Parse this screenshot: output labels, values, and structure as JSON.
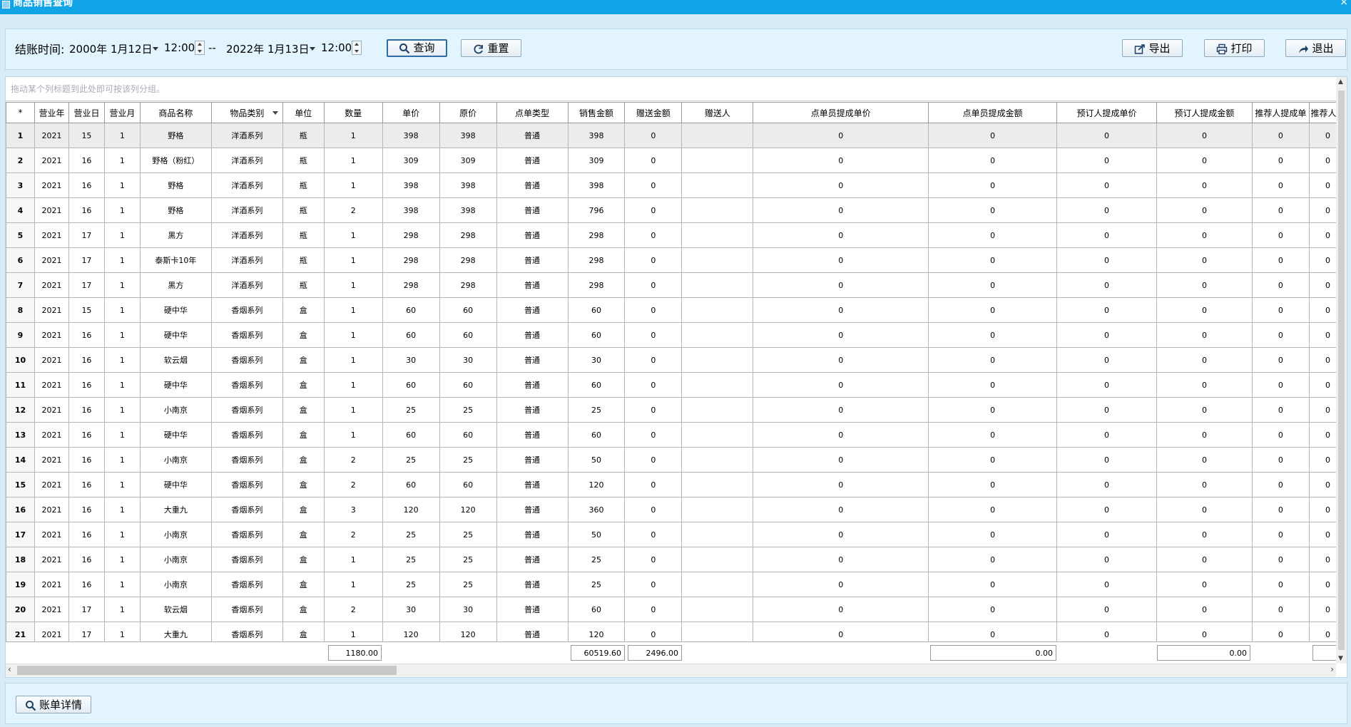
{
  "window": {
    "title": "商品销售查询",
    "close": "×"
  },
  "toolbar": {
    "label": "结账时间:",
    "start_date": "2000年 1月12日",
    "start_time": "12:00",
    "separator": "--",
    "end_date": "2022年 1月13日",
    "end_time": "12:00",
    "query": "查询",
    "reset": "重置",
    "export": "导出",
    "print": "打印",
    "exit": "退出"
  },
  "grid": {
    "group_hint": "拖动某个列标题到此处即可按该列分组。",
    "columns": [
      "*",
      "营业年",
      "营业日",
      "营业月",
      "商品名称",
      "物品类别",
      "单位",
      "数量",
      "单价",
      "原价",
      "点单类型",
      "销售金额",
      "赠送金额",
      "赠送人",
      "点单员提成单价",
      "点单员提成金额",
      "预订人提成单价",
      "预订人提成金额",
      "推荐人提成单",
      "推荐人提"
    ],
    "rows": [
      [
        "1",
        "2021",
        "15",
        "1",
        "野格",
        "洋酒系列",
        "瓶",
        "1",
        "398",
        "398",
        "普通",
        "398",
        "0",
        "",
        "0",
        "0",
        "0",
        "0",
        "0",
        "0"
      ],
      [
        "2",
        "2021",
        "16",
        "1",
        "野格（粉红）",
        "洋酒系列",
        "瓶",
        "1",
        "309",
        "309",
        "普通",
        "309",
        "0",
        "",
        "0",
        "0",
        "0",
        "0",
        "0",
        "0"
      ],
      [
        "3",
        "2021",
        "16",
        "1",
        "野格",
        "洋酒系列",
        "瓶",
        "1",
        "398",
        "398",
        "普通",
        "398",
        "0",
        "",
        "0",
        "0",
        "0",
        "0",
        "0",
        "0"
      ],
      [
        "4",
        "2021",
        "16",
        "1",
        "野格",
        "洋酒系列",
        "瓶",
        "2",
        "398",
        "398",
        "普通",
        "796",
        "0",
        "",
        "0",
        "0",
        "0",
        "0",
        "0",
        "0"
      ],
      [
        "5",
        "2021",
        "17",
        "1",
        "黑方",
        "洋酒系列",
        "瓶",
        "1",
        "298",
        "298",
        "普通",
        "298",
        "0",
        "",
        "0",
        "0",
        "0",
        "0",
        "0",
        "0"
      ],
      [
        "6",
        "2021",
        "17",
        "1",
        "泰斯卡10年",
        "洋酒系列",
        "瓶",
        "1",
        "298",
        "298",
        "普通",
        "298",
        "0",
        "",
        "0",
        "0",
        "0",
        "0",
        "0",
        "0"
      ],
      [
        "7",
        "2021",
        "17",
        "1",
        "黑方",
        "洋酒系列",
        "瓶",
        "1",
        "298",
        "298",
        "普通",
        "298",
        "0",
        "",
        "0",
        "0",
        "0",
        "0",
        "0",
        "0"
      ],
      [
        "8",
        "2021",
        "15",
        "1",
        "硬中华",
        "香烟系列",
        "盒",
        "1",
        "60",
        "60",
        "普通",
        "60",
        "0",
        "",
        "0",
        "0",
        "0",
        "0",
        "0",
        "0"
      ],
      [
        "9",
        "2021",
        "16",
        "1",
        "硬中华",
        "香烟系列",
        "盒",
        "1",
        "60",
        "60",
        "普通",
        "60",
        "0",
        "",
        "0",
        "0",
        "0",
        "0",
        "0",
        "0"
      ],
      [
        "10",
        "2021",
        "16",
        "1",
        "软云烟",
        "香烟系列",
        "盒",
        "1",
        "30",
        "30",
        "普通",
        "30",
        "0",
        "",
        "0",
        "0",
        "0",
        "0",
        "0",
        "0"
      ],
      [
        "11",
        "2021",
        "16",
        "1",
        "硬中华",
        "香烟系列",
        "盒",
        "1",
        "60",
        "60",
        "普通",
        "60",
        "0",
        "",
        "0",
        "0",
        "0",
        "0",
        "0",
        "0"
      ],
      [
        "12",
        "2021",
        "16",
        "1",
        "小南京",
        "香烟系列",
        "盒",
        "1",
        "25",
        "25",
        "普通",
        "25",
        "0",
        "",
        "0",
        "0",
        "0",
        "0",
        "0",
        "0"
      ],
      [
        "13",
        "2021",
        "16",
        "1",
        "硬中华",
        "香烟系列",
        "盒",
        "1",
        "60",
        "60",
        "普通",
        "60",
        "0",
        "",
        "0",
        "0",
        "0",
        "0",
        "0",
        "0"
      ],
      [
        "14",
        "2021",
        "16",
        "1",
        "小南京",
        "香烟系列",
        "盒",
        "2",
        "25",
        "25",
        "普通",
        "50",
        "0",
        "",
        "0",
        "0",
        "0",
        "0",
        "0",
        "0"
      ],
      [
        "15",
        "2021",
        "16",
        "1",
        "硬中华",
        "香烟系列",
        "盒",
        "2",
        "60",
        "60",
        "普通",
        "120",
        "0",
        "",
        "0",
        "0",
        "0",
        "0",
        "0",
        "0"
      ],
      [
        "16",
        "2021",
        "16",
        "1",
        "大重九",
        "香烟系列",
        "盒",
        "3",
        "120",
        "120",
        "普通",
        "360",
        "0",
        "",
        "0",
        "0",
        "0",
        "0",
        "0",
        "0"
      ],
      [
        "17",
        "2021",
        "16",
        "1",
        "小南京",
        "香烟系列",
        "盒",
        "2",
        "25",
        "25",
        "普通",
        "50",
        "0",
        "",
        "0",
        "0",
        "0",
        "0",
        "0",
        "0"
      ],
      [
        "18",
        "2021",
        "16",
        "1",
        "小南京",
        "香烟系列",
        "盒",
        "1",
        "25",
        "25",
        "普通",
        "25",
        "0",
        "",
        "0",
        "0",
        "0",
        "0",
        "0",
        "0"
      ],
      [
        "19",
        "2021",
        "16",
        "1",
        "小南京",
        "香烟系列",
        "盒",
        "1",
        "25",
        "25",
        "普通",
        "25",
        "0",
        "",
        "0",
        "0",
        "0",
        "0",
        "0",
        "0"
      ],
      [
        "20",
        "2021",
        "17",
        "1",
        "软云烟",
        "香烟系列",
        "盒",
        "2",
        "30",
        "30",
        "普通",
        "60",
        "0",
        "",
        "0",
        "0",
        "0",
        "0",
        "0",
        "0"
      ],
      [
        "21",
        "2021",
        "17",
        "1",
        "大重九",
        "香烟系列",
        "盒",
        "1",
        "120",
        "120",
        "普通",
        "120",
        "0",
        "",
        "0",
        "0",
        "0",
        "0",
        "0",
        "0"
      ]
    ],
    "totals": {
      "quantity": "1180.00",
      "sales": "60519.60",
      "gift": "2496.00",
      "order_commission": "0.00",
      "booking_commission": "0.00"
    }
  },
  "bottom": {
    "bill_detail": "账单详情"
  },
  "colors": {
    "titlebar": "#11a4e6",
    "panel": "#e2f4fd",
    "background": "#d8ecf8"
  }
}
